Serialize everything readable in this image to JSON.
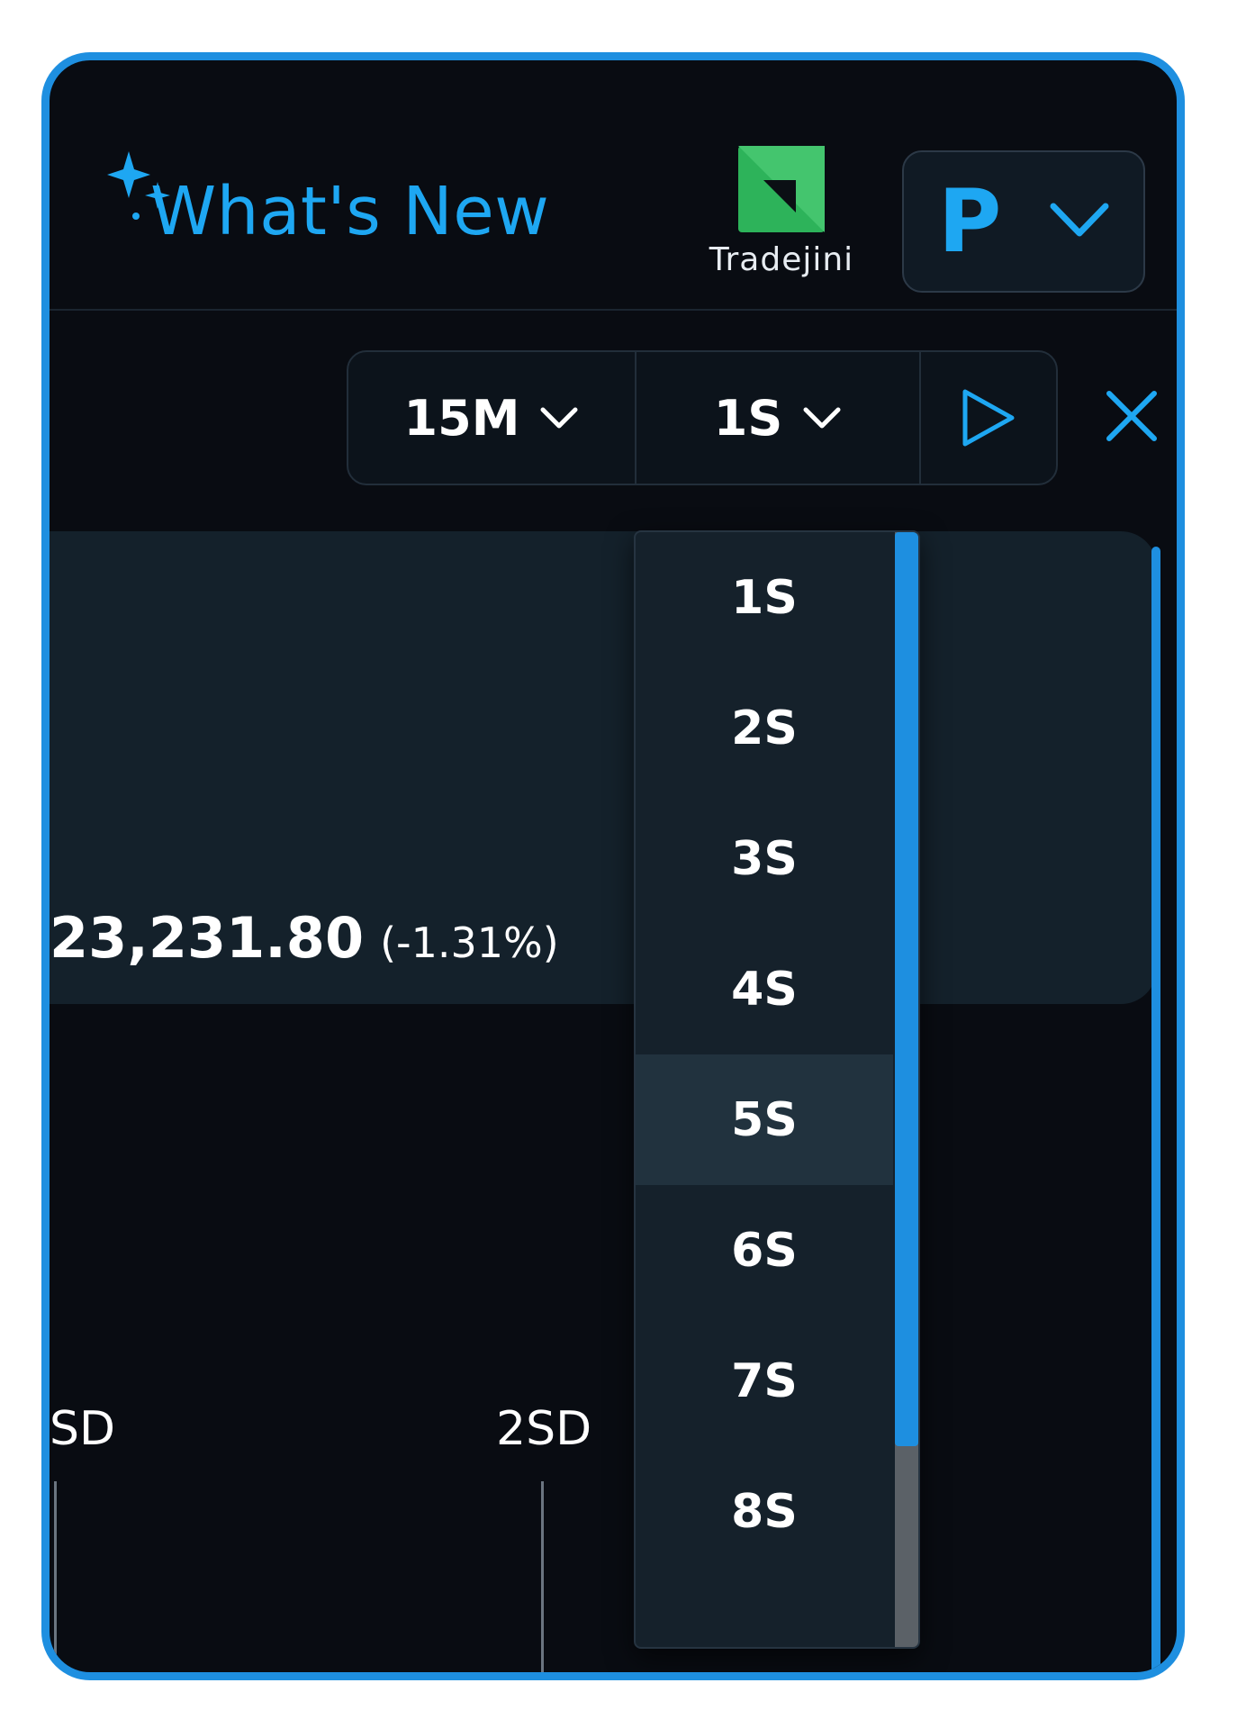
{
  "header": {
    "whats_new_label": "What's New",
    "brand_name": "Tradejini",
    "profile_initial": "P"
  },
  "toolbar": {
    "interval_value": "15M",
    "refresh_value": "1S"
  },
  "ticker": {
    "price": "23,231.80",
    "change_pct": "(-1.31%)"
  },
  "chart_labels": {
    "left_sd": "SD",
    "right_sd": "2SD"
  },
  "dropdown": {
    "items": [
      "1S",
      "2S",
      "3S",
      "4S",
      "5S",
      "6S",
      "7S",
      "8S"
    ],
    "highlighted": "5S"
  },
  "colors": {
    "accent": "#1ea7f2",
    "brand_green": "#2db35a",
    "background": "#090c12"
  }
}
